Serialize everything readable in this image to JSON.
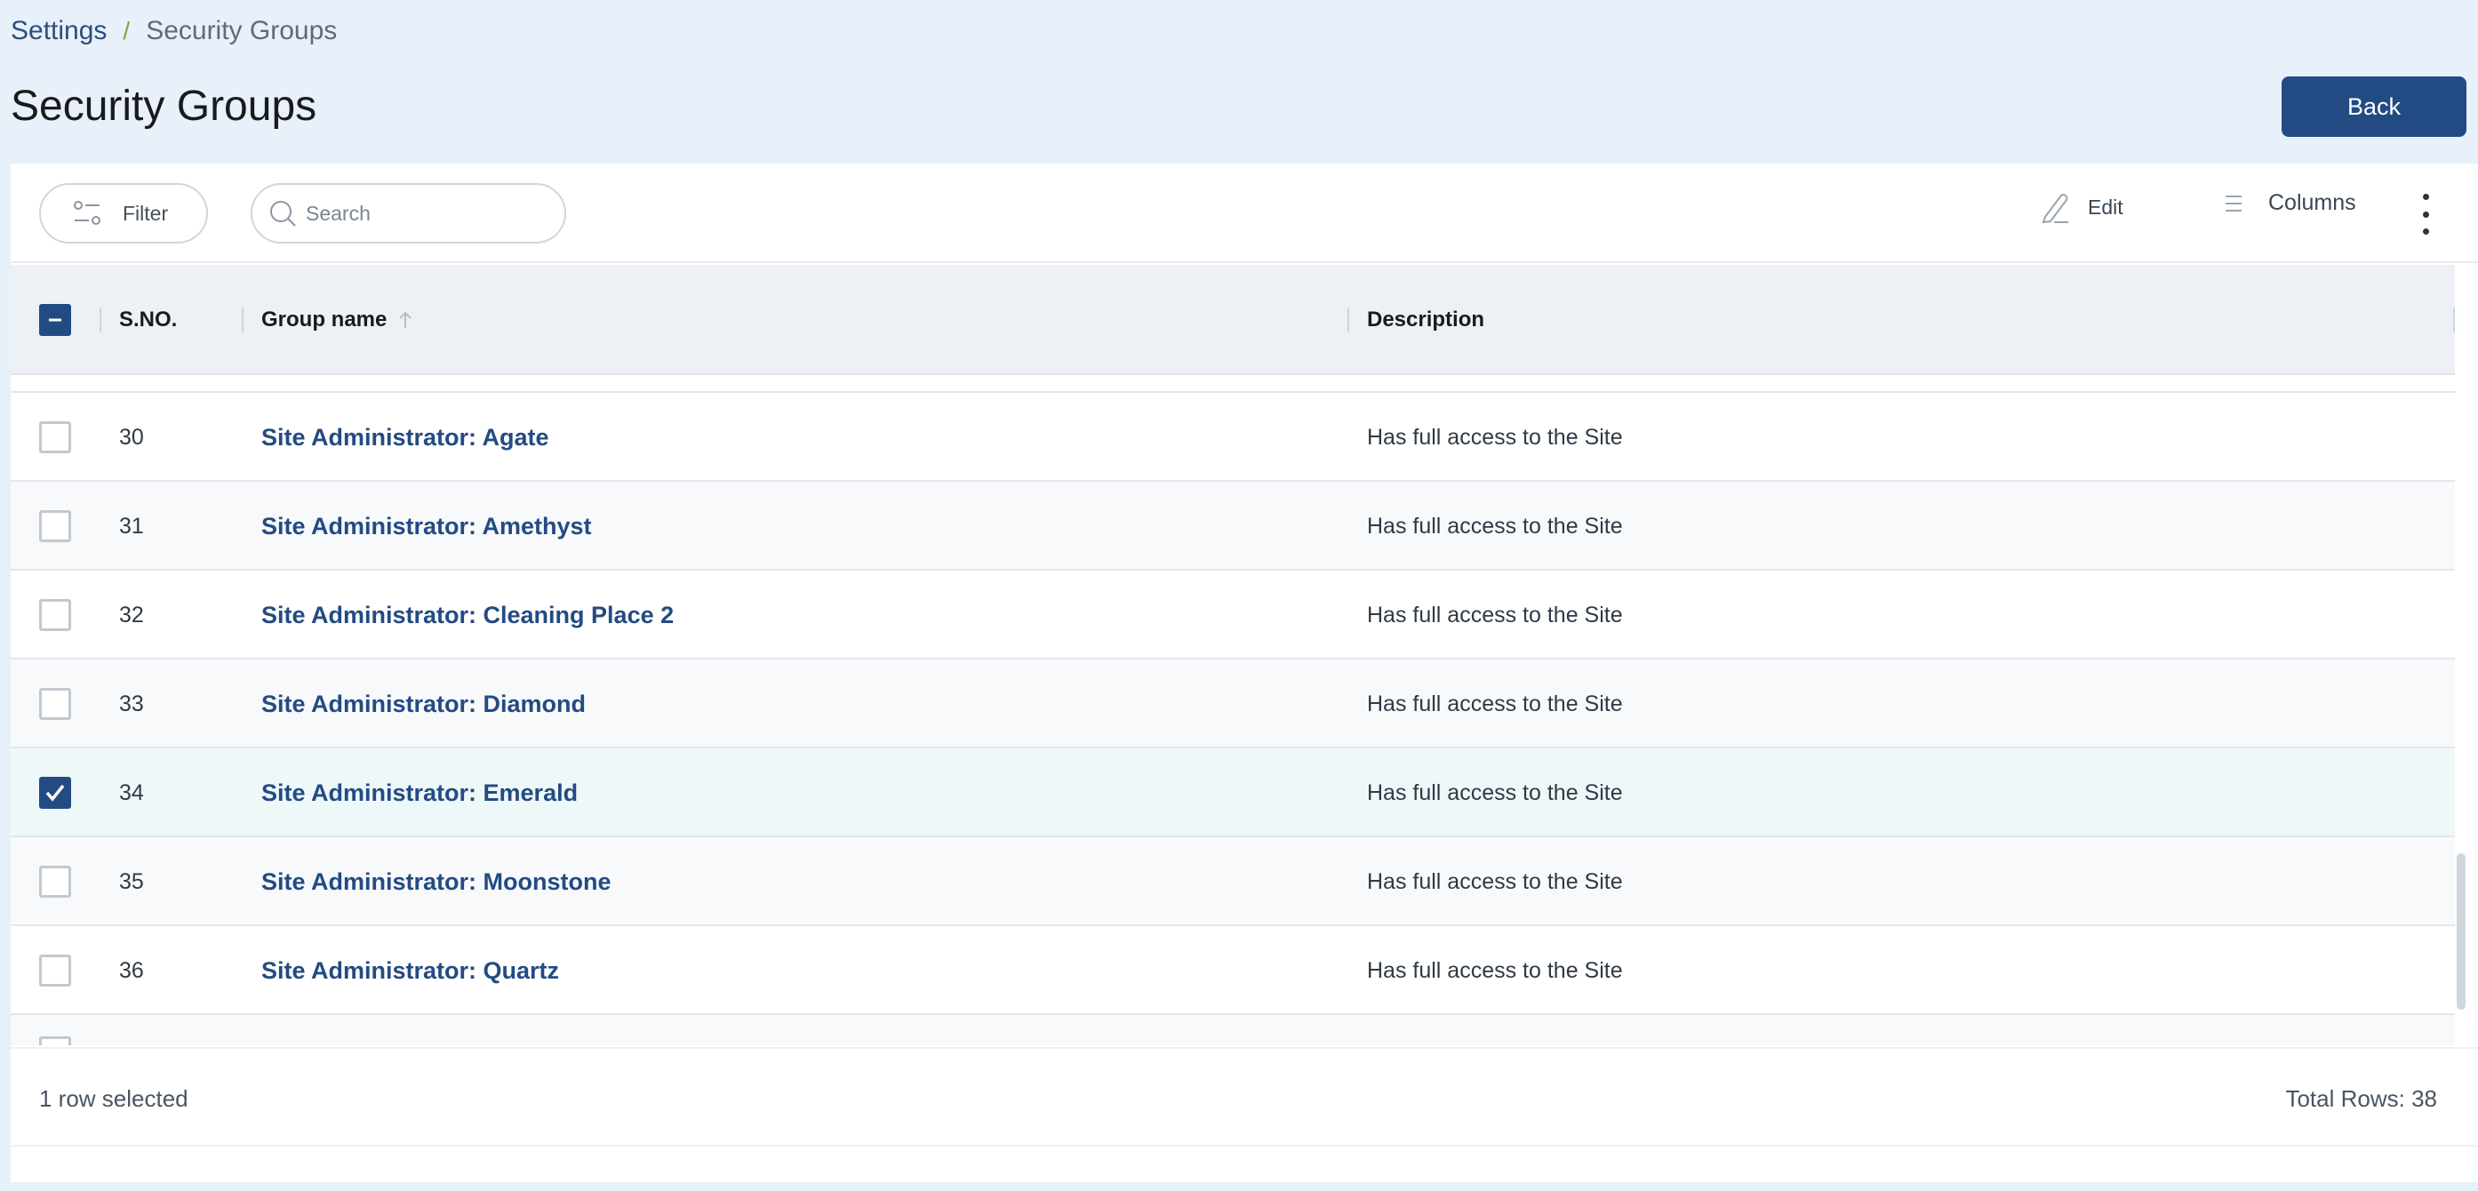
{
  "breadcrumb": {
    "root": "Settings",
    "separator": "/",
    "current": "Security Groups"
  },
  "page": {
    "title": "Security Groups",
    "back_label": "Back"
  },
  "toolbar": {
    "filter_label": "Filter",
    "search_placeholder": "Search",
    "search_value": "",
    "edit_label": "Edit",
    "columns_label": "Columns"
  },
  "table": {
    "header_checkbox_state": "partial",
    "columns": {
      "sno": "S.NO.",
      "group_name": "Group name",
      "description": "Description"
    },
    "sort": {
      "column": "group_name",
      "direction": "asc"
    },
    "rows": [
      {
        "sno": "30",
        "name": "Site Administrator: Agate",
        "description": "Has full access to the Site",
        "checked": false
      },
      {
        "sno": "31",
        "name": "Site Administrator: Amethyst",
        "description": "Has full access to the Site",
        "checked": false
      },
      {
        "sno": "32",
        "name": "Site Administrator: Cleaning Place 2",
        "description": "Has full access to the Site",
        "checked": false
      },
      {
        "sno": "33",
        "name": "Site Administrator: Diamond",
        "description": "Has full access to the Site",
        "checked": false
      },
      {
        "sno": "34",
        "name": "Site Administrator: Emerald",
        "description": "Has full access to the Site",
        "checked": true
      },
      {
        "sno": "35",
        "name": "Site Administrator: Moonstone",
        "description": "Has full access to the Site",
        "checked": false
      },
      {
        "sno": "36",
        "name": "Site Administrator: Quartz",
        "description": "Has full access to the Site",
        "checked": false
      }
    ]
  },
  "footer": {
    "selected_text": "1 row selected",
    "total_rows": "Total Rows: 38"
  },
  "colors": {
    "primary": "#234b83",
    "background": "#e8f0fa",
    "selected_row": "#eef8f8",
    "link": "#234b83"
  }
}
